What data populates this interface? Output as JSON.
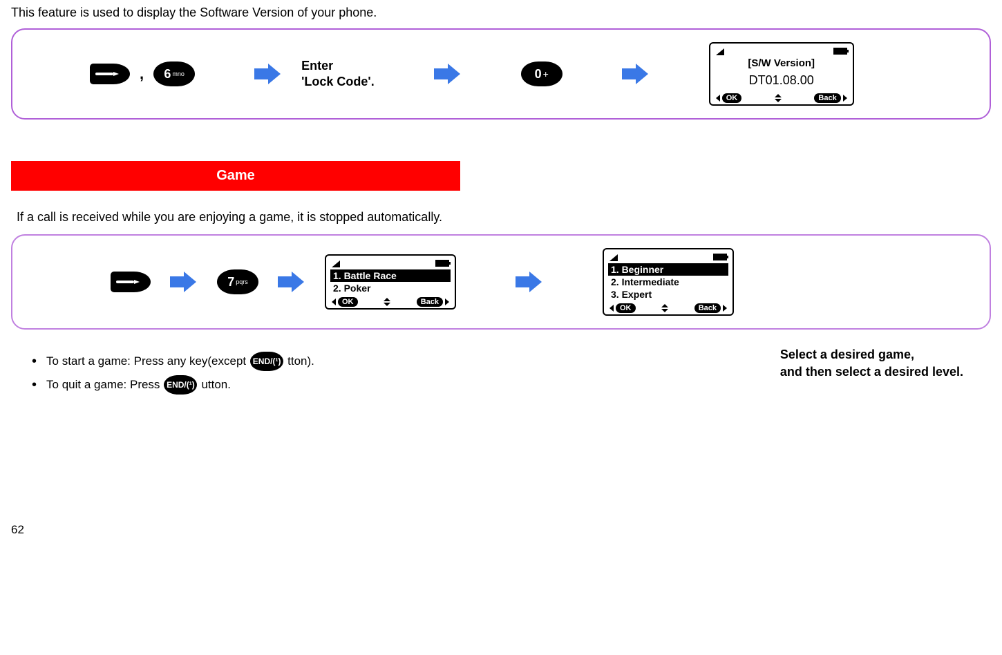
{
  "intro": "This feature is used to display the Software Version of your phone.",
  "flow1": {
    "key_6": "6",
    "key_6_sub": "mno",
    "enter_line1": "Enter",
    "enter_line2": "'Lock Code'.",
    "key_0": "0",
    "key_0_sub": "+",
    "screen": {
      "title": "[S/W Version]",
      "value": "DT01.08.00",
      "ok": "OK",
      "back": "Back"
    }
  },
  "banner": "Game",
  "game_note": "If a call is received while you are enjoying a game, it is stopped automatically.",
  "flow2": {
    "key_7": "7",
    "key_7_sub": "pqrs",
    "screen_games": {
      "items": [
        "1. Battle Race",
        "2. Poker"
      ],
      "ok": "OK",
      "back": "Back"
    },
    "screen_levels": {
      "items": [
        "1. Beginner",
        "2. Intermediate",
        "3. Expert"
      ],
      "ok": "OK",
      "back": "Back"
    }
  },
  "bullets": {
    "b1_pre": "To start a game: Press any key(except ",
    "b1_key": "END/(¹)",
    "b1_post": "tton).",
    "b2_pre": "To quit a game: Press ",
    "b2_key": "END/(¹)",
    "b2_post": "utton."
  },
  "right_instr_l1": "Select a desired game,",
  "right_instr_l2": "and then select a desired level.",
  "page": "62"
}
